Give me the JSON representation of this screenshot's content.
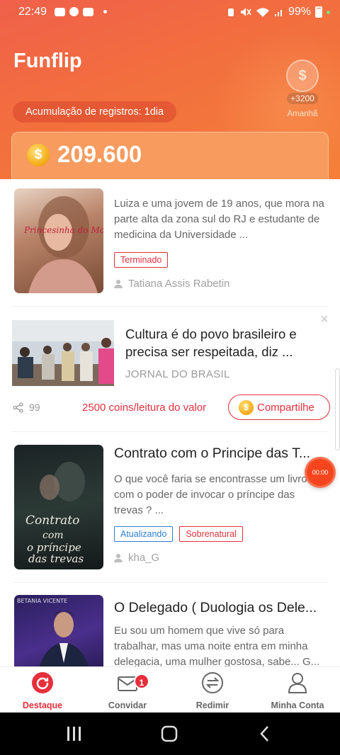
{
  "status_bar": {
    "time": "22:49",
    "battery": "99%"
  },
  "header": {
    "title": "Funflip",
    "streak_label": "Acumulação de registros: 1dia",
    "bonus_amount": "+3200",
    "bonus_label": "Amanhã",
    "balance": "209.600"
  },
  "books": [
    {
      "description": "Luiza e uma jovem de 19 anos, que mora na parte alta da zona sul do RJ e estudante de medicina da Universidade ...",
      "cover_text": "Princesinha do Morro",
      "tags": [
        "Terminado"
      ],
      "author": "Tatiana Assis Rabetin"
    },
    {
      "title": "Contrato com o Principe das T...",
      "description": "O que você faria se encontrasse um livro com o poder de invocar o príncipe das trevas ? ...",
      "cover_text": "Contrato com o príncipe das trevas",
      "tags": [
        "Atualizando",
        "Sobrenatural"
      ],
      "author": "kha_G"
    },
    {
      "title": "O Delegado ( Duologia os Dele...",
      "description": "Eu sou um homem que vive só para trabalhar, mas uma noite entra em minha delegacia, uma mulher gostosa, sabe... G...",
      "cover_text": "BETANIA VICENTE"
    }
  ],
  "news": {
    "title": "Cultura é do povo brasileiro e precisa ser respeitada, diz ...",
    "source": "JORNAL DO BRASIL",
    "share_count": "99",
    "reward_text": "2500 coins/leitura do valor",
    "share_button": "Compartilhe"
  },
  "timer": "00:00",
  "nav": [
    {
      "label": "Destaque",
      "icon": "home-icon",
      "active": true
    },
    {
      "label": "Convidar",
      "icon": "invite-icon",
      "badge": "1"
    },
    {
      "label": "Redimir",
      "icon": "redeem-icon"
    },
    {
      "label": "Minha Conta",
      "icon": "account-icon"
    }
  ],
  "colors": {
    "accent": "#e5303c",
    "header_start": "#f0604a",
    "header_end": "#f57f38",
    "link_blue": "#2d7fd3"
  }
}
